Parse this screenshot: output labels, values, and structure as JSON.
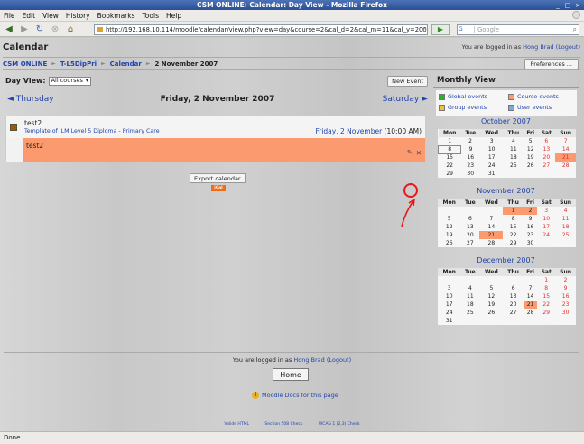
{
  "browser": {
    "title": "CSM ONLINE: Calendar: Day View - Mozilla Firefox",
    "menus": [
      "File",
      "Edit",
      "View",
      "History",
      "Bookmarks",
      "Tools",
      "Help"
    ],
    "url": "http://192.168.10.114/moodle/calendar/view.php?view=day&course=2&cal_d=2&cal_m=11&cal_y=2007",
    "search_placeholder": "Google",
    "search_engine": "G",
    "status": "Done"
  },
  "header": {
    "title": "Calendar",
    "login_prefix": "You are logged in as",
    "login_user": "Hong Brad",
    "logout": "(Logout)"
  },
  "breadcrumb": {
    "items": [
      "CSM ONLINE",
      "T-L5DipPri",
      "Calendar"
    ],
    "current": "2 November 2007",
    "separator": "►"
  },
  "preferences_label": "Preferences ...",
  "dayview": {
    "label": "Day View:",
    "selected": "All courses",
    "new_event": "New Event",
    "prev": "◄ Thursday",
    "current": "Friday, 2 November 2007",
    "next": "Saturday ►"
  },
  "event": {
    "name": "test2",
    "course": "Template of ILM Level 5 Diploma - Primary Care",
    "date_link": "Friday, 2 November",
    "time": "(10:00 AM)",
    "description": "test2"
  },
  "export_label": "Export calendar",
  "ical_label": "iCal",
  "sidebar": {
    "title": "Monthly View",
    "legend": {
      "global": "Global events",
      "course": "Course events",
      "group": "Group events",
      "user": "User events"
    },
    "weekdays": [
      "Mon",
      "Tue",
      "Wed",
      "Thu",
      "Fri",
      "Sat",
      "Sun"
    ],
    "months": [
      {
        "title": "October 2007",
        "weeks": [
          [
            "1",
            "2",
            "3",
            "4",
            "5",
            "6",
            "7"
          ],
          [
            "8",
            "9",
            "10",
            "11",
            "12",
            "13",
            "14"
          ],
          [
            "15",
            "16",
            "17",
            "18",
            "19",
            "20",
            "21"
          ],
          [
            "22",
            "23",
            "24",
            "25",
            "26",
            "27",
            "28"
          ],
          [
            "29",
            "30",
            "31",
            "",
            "",
            "",
            ""
          ]
        ]
      },
      {
        "title": "November 2007",
        "weeks": [
          [
            "",
            "",
            "",
            "1",
            "2",
            "3",
            "4"
          ],
          [
            "5",
            "6",
            "7",
            "8",
            "9",
            "10",
            "11"
          ],
          [
            "12",
            "13",
            "14",
            "15",
            "16",
            "17",
            "18"
          ],
          [
            "19",
            "20",
            "21",
            "22",
            "23",
            "24",
            "25"
          ],
          [
            "26",
            "27",
            "28",
            "29",
            "30",
            "",
            ""
          ]
        ]
      },
      {
        "title": "December 2007",
        "weeks": [
          [
            "",
            "",
            "",
            "",
            "",
            "1",
            "2"
          ],
          [
            "3",
            "4",
            "5",
            "6",
            "7",
            "8",
            "9"
          ],
          [
            "10",
            "11",
            "12",
            "13",
            "14",
            "15",
            "16"
          ],
          [
            "17",
            "18",
            "19",
            "20",
            "21",
            "22",
            "23"
          ],
          [
            "24",
            "25",
            "26",
            "27",
            "28",
            "29",
            "30"
          ],
          [
            "31",
            "",
            "",
            "",
            "",
            "",
            ""
          ]
        ]
      }
    ]
  },
  "footer": {
    "login_prefix": "You are logged in as",
    "login_user": "Hong Brad",
    "logout": "(Logout)",
    "home": "Home",
    "docs": "Moodle Docs for this page",
    "validators": [
      "Valide HTML",
      "Section 508 Check",
      "WCAG 1 (2,3) Check"
    ]
  },
  "colors": {
    "event": "#fb9a6e",
    "link": "#2244aa",
    "weekend": "#e03030",
    "annotation": "#e8181a"
  }
}
